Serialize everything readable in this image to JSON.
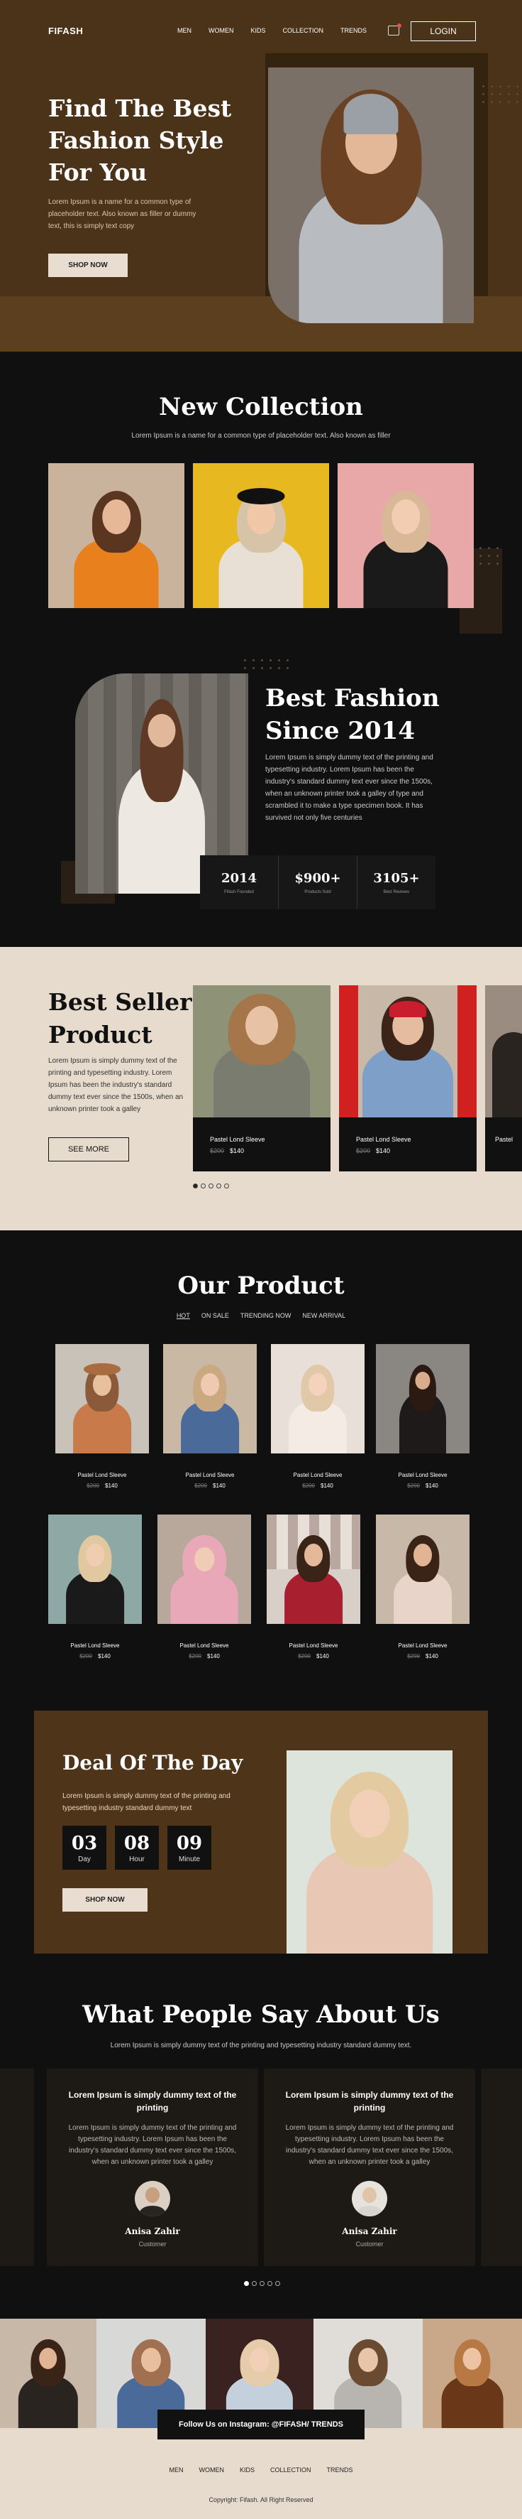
{
  "nav": {
    "logo": "FIFASH",
    "links": [
      "MEN",
      "WOMEN",
      "KIDS",
      "COLLECTION",
      "TRENDS"
    ],
    "login": "LOGIN"
  },
  "hero": {
    "title": "Find The Best Fashion Style For You",
    "text": "Lorem Ipsum is a name for a common type of placeholder text. Also known as filler or dummy text, this is simply text copy",
    "button": "SHOP NOW"
  },
  "collection": {
    "title": "New Collection",
    "subtitle": "Lorem Ipsum is a name for a common type of placeholder text. Also known as filler"
  },
  "about": {
    "title": "Best Fashion Since 2014",
    "text": "Lorem Ipsum is simply dummy text of the printing and typesetting industry. Lorem Ipsum has been the industry's standard dummy text ever since the 1500s, when an unknown printer took a galley of type and scrambled it to make a type specimen book.  It has survived not only five centuries",
    "stats": [
      {
        "value": "2014",
        "label": "Fifash Founded"
      },
      {
        "value": "$900+",
        "label": "Products Sold"
      },
      {
        "value": "3105+",
        "label": "Best Reviews"
      }
    ]
  },
  "bestseller": {
    "title": "Best Seller Product",
    "text": "Lorem Ipsum is simply dummy text of the printing and typesetting industry. Lorem Ipsum has been the industry's standard dummy text ever since the 1500s, when an unknown printer took a galley",
    "button": "SEE MORE",
    "cards": [
      {
        "name": "Pastel Lond Sleeve",
        "old": "$200",
        "price": "$140"
      },
      {
        "name": "Pastel Lond Sleeve",
        "old": "$200",
        "price": "$140"
      },
      {
        "name": "Pastel",
        "old": "",
        "price": ""
      }
    ]
  },
  "products": {
    "title": "Our Product",
    "tabs": [
      "HOT",
      "ON SALE",
      "TRENDING NOW",
      "NEW ARRIVAL"
    ],
    "items": [
      {
        "name": "Pastel Lond Sleeve",
        "old": "$200",
        "price": "$140"
      },
      {
        "name": "Pastel Lond Sleeve",
        "old": "$200",
        "price": "$140"
      },
      {
        "name": "Pastel Lond Sleeve",
        "old": "$200",
        "price": "$140"
      },
      {
        "name": "Pastel Lond Sleeve",
        "old": "$200",
        "price": "$140"
      },
      {
        "name": "Pastel Lond Sleeve",
        "old": "$200",
        "price": "$140"
      },
      {
        "name": "Pastel Lond Sleeve",
        "old": "$200",
        "price": "$140"
      },
      {
        "name": "Pastel Lond Sleeve",
        "old": "$200",
        "price": "$140"
      },
      {
        "name": "Pastel Lond Sleeve",
        "old": "$200",
        "price": "$140"
      }
    ]
  },
  "deal": {
    "title": "Deal Of The Day",
    "text": "Lorem Ipsum is simply dummy text of the printing and typesetting industry standard dummy text",
    "timer": [
      {
        "value": "03",
        "label": "Day"
      },
      {
        "value": "08",
        "label": "Hour"
      },
      {
        "value": "09",
        "label": "Minute"
      }
    ],
    "button": "SHOP NOW"
  },
  "testimonials": {
    "title": "What People Say About Us",
    "subtitle": "Lorem Ipsum is simply dummy text of the printing and typesetting industry standard dummy text.",
    "items": [
      {
        "heading": "Lorem Ipsum is simply dummy text of the printing",
        "body": "Lorem Ipsum is simply dummy text of the printing and typesetting industry. Lorem Ipsum has been the industry's standard dummy text ever since the 1500s, when an unknown printer took a galley",
        "name": "Anisa Zahir",
        "role": "Customer"
      },
      {
        "heading": "Lorem Ipsum is simply dummy text of the printing",
        "body": "Lorem Ipsum is simply dummy text of the printing and typesetting industry. Lorem Ipsum has been the industry's standard dummy text ever since the 1500s, when an unknown printer took a galley",
        "name": "Anisa Zahir",
        "role": "Customer"
      }
    ]
  },
  "footer": {
    "instagram": "Follow Us on Instagram: @FIFASH/ TRENDS",
    "links": [
      "MEN",
      "WOMEN",
      "KIDS",
      "COLLECTION",
      "TRENDS"
    ],
    "copyright": "Copyright: Fifash. All Right Reserved"
  },
  "colors": {
    "brown": "#4a3318",
    "dark": "#101010",
    "cream": "#e6dbcd"
  }
}
